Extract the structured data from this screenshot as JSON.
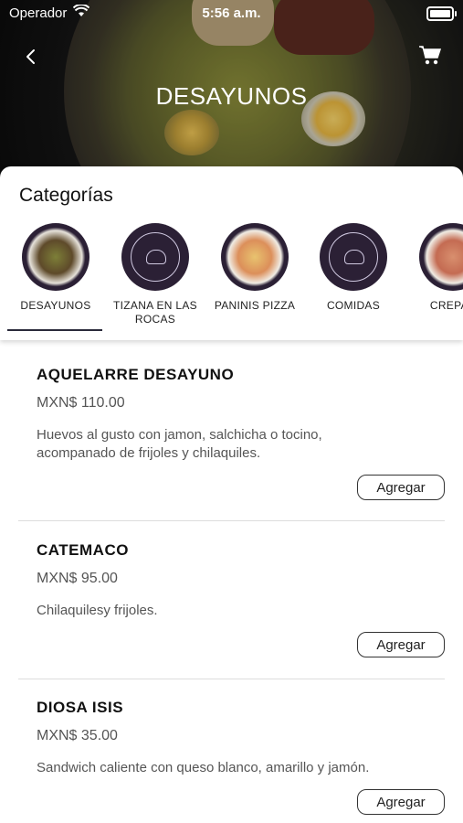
{
  "status_bar": {
    "carrier": "Operador",
    "time": "5:56 a.m."
  },
  "header": {
    "title": "DESAYUNOS"
  },
  "categories": {
    "heading": "Categorías",
    "items": [
      {
        "label": "DESAYUNOS",
        "selected": true,
        "thumb": "food-photo"
      },
      {
        "label": "TIZANA EN LAS ROCAS",
        "selected": false,
        "thumb": "logo"
      },
      {
        "label": "PANINIS PIZZA",
        "selected": false,
        "thumb": "food-photo"
      },
      {
        "label": "COMIDAS",
        "selected": false,
        "thumb": "logo"
      },
      {
        "label": "CREPAS",
        "selected": false,
        "thumb": "food-photo"
      }
    ]
  },
  "menu_items": [
    {
      "name": "AQUELARRE DESAYUNO",
      "price": "MXN$ 110.00",
      "description": "Huevos al gusto con jamon, salchicha o tocino, acompanado de frijoles y chilaquiles.",
      "button": "Agregar"
    },
    {
      "name": "CATEMACO",
      "price": "MXN$ 95.00",
      "description": "Chilaquilesy frijoles.",
      "button": "Agregar"
    },
    {
      "name": "DIOSA ISIS",
      "price": "MXN$ 35.00",
      "description": "Sandwich caliente con queso blanco, amarillo y jamón.",
      "button": "Agregar"
    }
  ],
  "colors": {
    "accent": "#2a2a3a",
    "category_bg": "#2b2035"
  },
  "icons": {
    "back": "chevron-left-icon",
    "cart": "cart-icon",
    "wifi": "wifi-icon",
    "battery": "battery-icon"
  }
}
